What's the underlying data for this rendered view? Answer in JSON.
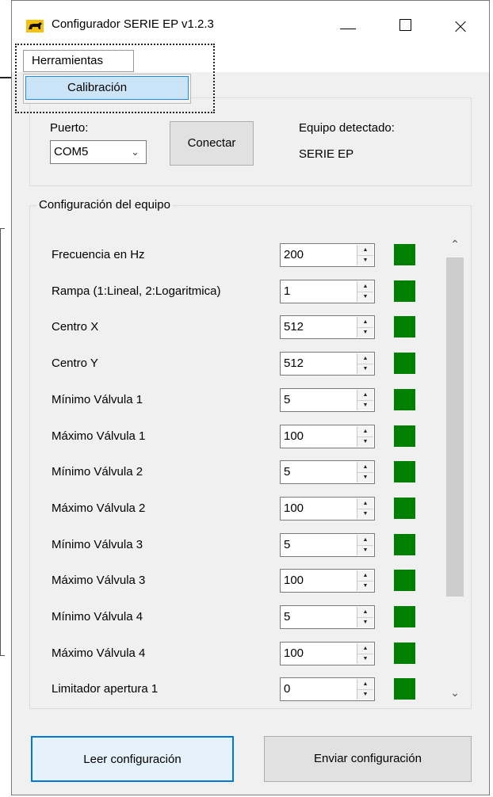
{
  "window": {
    "title": "Configurador SERIE EP v1.2.3",
    "controls": {
      "minimize": "minimize-icon",
      "maximize": "maximize-icon",
      "close": "close-icon"
    },
    "app_icon": "bull-logo-icon"
  },
  "menu": {
    "items": [
      {
        "label": "Herramientas"
      }
    ],
    "dropdown": [
      {
        "label": "Calibración"
      }
    ]
  },
  "connection": {
    "port_label": "Puerto:",
    "port_value": "COM5",
    "connect_label": "Conectar",
    "detected_label": "Equipo detectado:",
    "detected_value": "SERIE EP"
  },
  "config": {
    "group_title": "Configuración del equipo",
    "params": [
      {
        "label": "Frecuencia en Hz",
        "value": "200"
      },
      {
        "label": "Rampa (1:Lineal, 2:Logaritmica)",
        "value": "1"
      },
      {
        "label": "Centro X",
        "value": "512"
      },
      {
        "label": "Centro Y",
        "value": "512"
      },
      {
        "label": "Mínimo Válvula 1",
        "value": "5"
      },
      {
        "label": "Máximo Válvula 1",
        "value": "100"
      },
      {
        "label": "Mínimo Válvula 2",
        "value": "5"
      },
      {
        "label": "Máximo Válvula 2",
        "value": "100"
      },
      {
        "label": "Mínimo Válvula 3",
        "value": "5"
      },
      {
        "label": "Máximo Válvula 3",
        "value": "100"
      },
      {
        "label": "Mínimo Válvula 4",
        "value": "5"
      },
      {
        "label": "Máximo Válvula 4",
        "value": "100"
      },
      {
        "label": "Limitador apertura 1",
        "value": "0"
      }
    ],
    "status_color": "#008000"
  },
  "actions": {
    "read_label": "Leer configuración",
    "send_label": "Enviar configuración"
  }
}
